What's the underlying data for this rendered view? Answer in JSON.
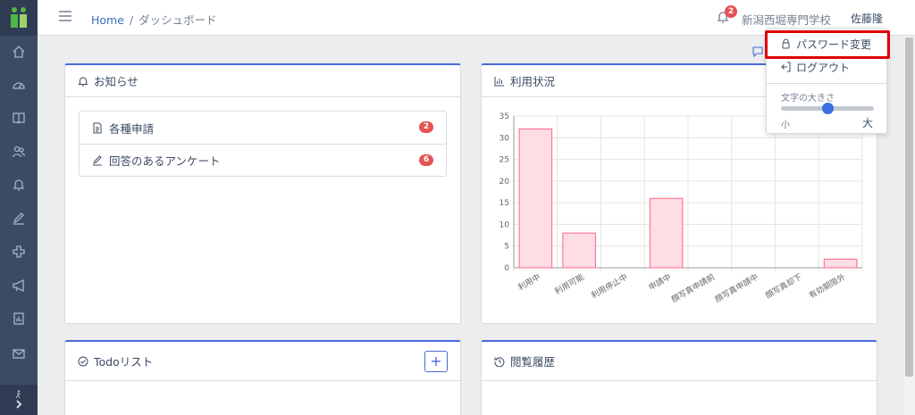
{
  "sidebar": {
    "items": [
      "home-icon",
      "speedometer-icon",
      "book-icon",
      "people-icon",
      "bell-icon",
      "pencil-icon",
      "plus-icon",
      "megaphone-icon",
      "report-icon",
      "mail-icon"
    ],
    "bottom_icons": [
      "walk-icon",
      "chevron-right-icon"
    ]
  },
  "header": {
    "breadcrumb": {
      "home": "Home",
      "separator": "/",
      "current": "ダッシュボード"
    },
    "notification_count": "2",
    "school_name": "新潟西堀専門学校",
    "user_name": "佐藤隆"
  },
  "user_menu": {
    "items": [
      {
        "label": "パスワード変更",
        "icon": "lock-icon"
      },
      {
        "label": "ログアウト",
        "icon": "logout-icon"
      }
    ],
    "font_size_label": "文字の大きさ",
    "slider_value": 0.5,
    "small_label": "小",
    "large_label": "大"
  },
  "notices": {
    "title": "お知らせ",
    "items": [
      {
        "label": "各種申請",
        "count": "2",
        "icon": "document-icon"
      },
      {
        "label": "回答のあるアンケート",
        "count": "6",
        "icon": "pencil-icon"
      }
    ]
  },
  "usage": {
    "title": "利用状況"
  },
  "todo": {
    "title": "Todoリスト",
    "add_label": "+"
  },
  "history": {
    "title": "閲覧履歴"
  },
  "colors": {
    "sidebar": "#3c4b64",
    "accent": "#4a69d8",
    "badge": "#e55353",
    "bar_fill": "#ffdde4",
    "bar_stroke": "#ff6384"
  },
  "chart_data": {
    "type": "bar",
    "categories": [
      "利用中",
      "利用可能",
      "利用停止中",
      "申請中",
      "顔写真申請前",
      "顔写真申請中",
      "顔写真却下",
      "有効期限外"
    ],
    "values": [
      32,
      8,
      0,
      16,
      0,
      0,
      0,
      2
    ],
    "ylim": [
      0,
      35
    ],
    "yticks": [
      0,
      5,
      10,
      15,
      20,
      25,
      30,
      35
    ],
    "grid": true,
    "legend": "none"
  }
}
